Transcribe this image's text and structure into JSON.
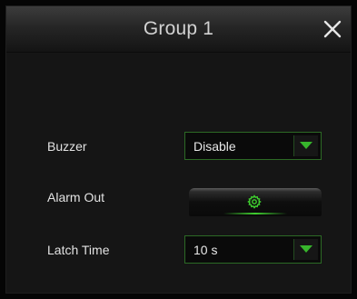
{
  "dialog": {
    "title": "Group 1",
    "close_icon": "close-icon"
  },
  "fields": {
    "buzzer": {
      "label": "Buzzer",
      "value": "Disable",
      "icon": "chevron-down-icon"
    },
    "alarm_out": {
      "label": "Alarm Out",
      "icon": "gear-icon"
    },
    "latch_time": {
      "label": "Latch Time",
      "value": "10 s",
      "icon": "chevron-down-icon"
    }
  },
  "colors": {
    "accent": "#37b52c",
    "border_accent": "#2c6a25",
    "text": "#e2e2e2",
    "background": "#151515"
  }
}
